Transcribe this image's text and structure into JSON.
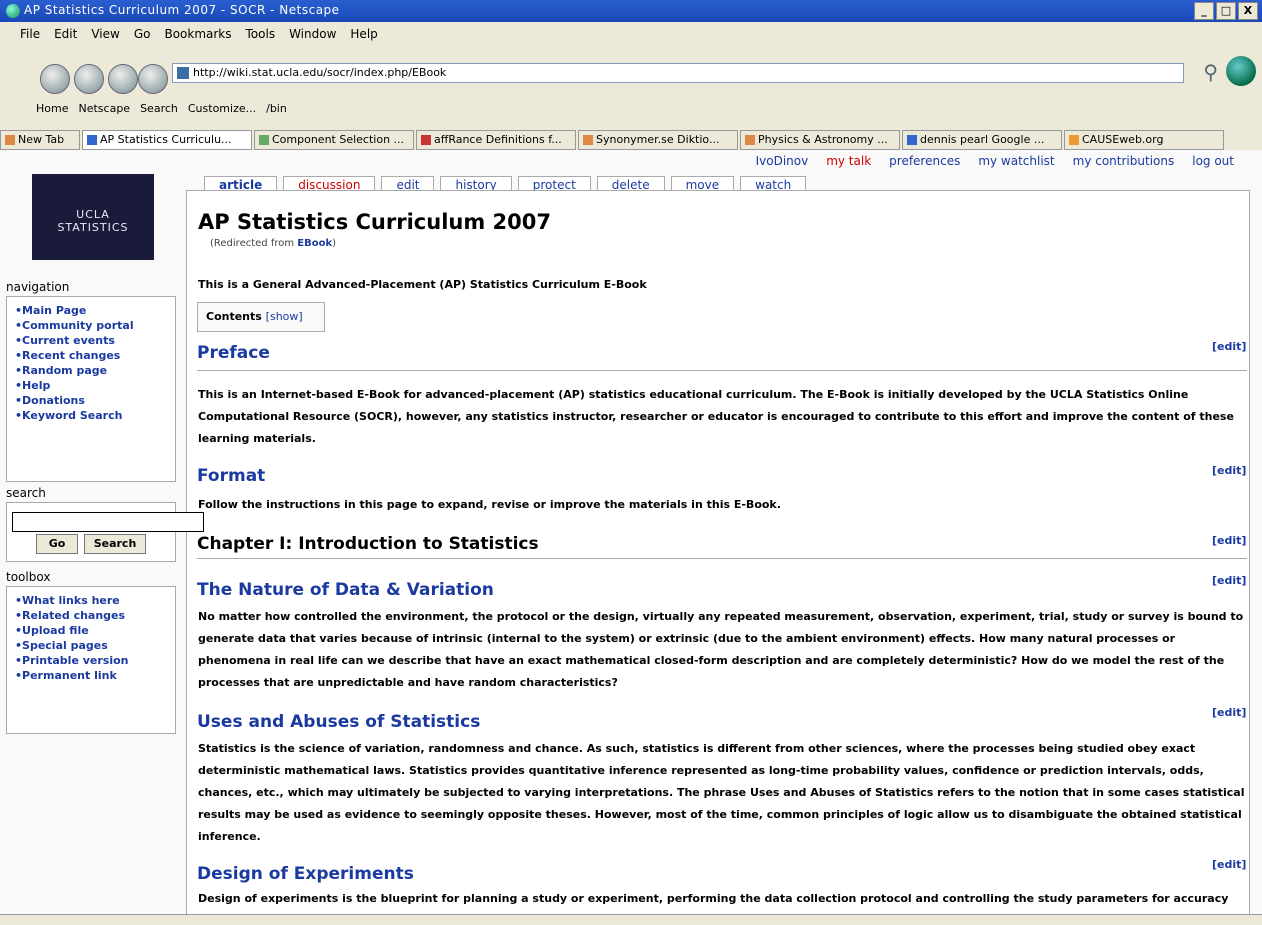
{
  "window": {
    "title": "AP Statistics Curriculum 2007 - SOCR - Netscape",
    "buttons": [
      "_",
      "□",
      "X"
    ]
  },
  "menu": [
    "File",
    "Edit",
    "View",
    "Go",
    "Bookmarks",
    "Tools",
    "Window",
    "Help"
  ],
  "url": "http://wiki.stat.ucla.edu/socr/index.php/EBook",
  "bookmarks": [
    "Home",
    "Netscape",
    "Search",
    "Customize...",
    "/bin"
  ],
  "tabs": [
    "New Tab",
    "AP Statistics Curriculu...",
    "Component Selection ...",
    "affRance Definitions f...",
    "Synonymer.se Diktio...",
    "Physics & Astronomy ...",
    "dennis pearl Google ...",
    "CAUSEweb.org"
  ],
  "personal": {
    "user": "IvoDinov",
    "talk": "my talk",
    "prefs": "preferences",
    "watch": "my watchlist",
    "contrib": "my contributions",
    "logout": "log out"
  },
  "page_tabs": {
    "article": "article",
    "discussion": "discussion",
    "edit": "edit",
    "history": "history",
    "protect": "protect",
    "delete": "delete",
    "move": "move",
    "watch": "watch"
  },
  "logo": {
    "l1": "UCLA",
    "l2": "STATISTICS"
  },
  "sidebar": {
    "nav_title": "navigation",
    "nav": [
      "Main Page",
      "Community portal",
      "Current events",
      "Recent changes",
      "Random page",
      "Help",
      "Donations",
      "Keyword Search"
    ],
    "search_title": "search",
    "go": "Go",
    "search": "Search",
    "toolbox_title": "toolbox",
    "toolbox": [
      "What links here",
      "Related changes",
      "Upload file",
      "Special pages",
      "Printable version",
      "Permanent link"
    ]
  },
  "article": {
    "title": "AP Statistics Curriculum 2007",
    "redirect": "(Redirected from",
    "redirect_link": "EBook",
    "redirect_close": ")",
    "intro": "This is a General Advanced-Placement (AP) Statistics Curriculum E-Book",
    "contents": "Contents",
    "show": "[show]",
    "edit": "[edit]",
    "preface": "Preface",
    "preface_text": "This is an Internet-based E-Book for advanced-placement (AP) statistics educational curriculum. The E-Book is initially developed by the UCLA Statistics Online Computational Resource (SOCR), however, any statistics instructor, researcher or educator is encouraged to contribute to this effort and improve the content of these learning materials.",
    "format": "Format",
    "format_text": "Follow the instructions in this page to expand, revise or improve the materials in this E-Book.",
    "chapter": "Chapter I: Introduction to Statistics",
    "nature": "The Nature of Data & Variation",
    "nature_text": "No matter how controlled the environment, the protocol or the design, virtually any repeated measurement, observation, experiment, trial, study or survey is bound to generate data that varies because of intrinsic (internal to the system) or extrinsic (due to the ambient environment) effects. How many natural processes or phenomena in real life can we describe that have an exact mathematical closed-form description and are completely deterministic? How do we model the rest of the processes that are unpredictable and have random characteristics?",
    "uses": "Uses and Abuses of Statistics",
    "uses_text": "Statistics is the science of variation, randomness and chance. As such, statistics is different from other sciences, where the processes being studied obey exact deterministic mathematical laws. Statistics provides quantitative inference represented as long-time probability values, confidence or prediction intervals, odds, chances, etc., which may ultimately be subjected to varying interpretations. The phrase Uses and Abuses of Statistics refers to the notion that in some cases statistical results may be used as evidence to seemingly opposite theses. However, most of the time, common principles of logic allow us to disambiguate the obtained statistical inference.",
    "design": "Design of Experiments",
    "design_text": "Design of experiments is the blueprint for planning a study or experiment, performing the data collection protocol and controlling the study parameters for accuracy and"
  }
}
